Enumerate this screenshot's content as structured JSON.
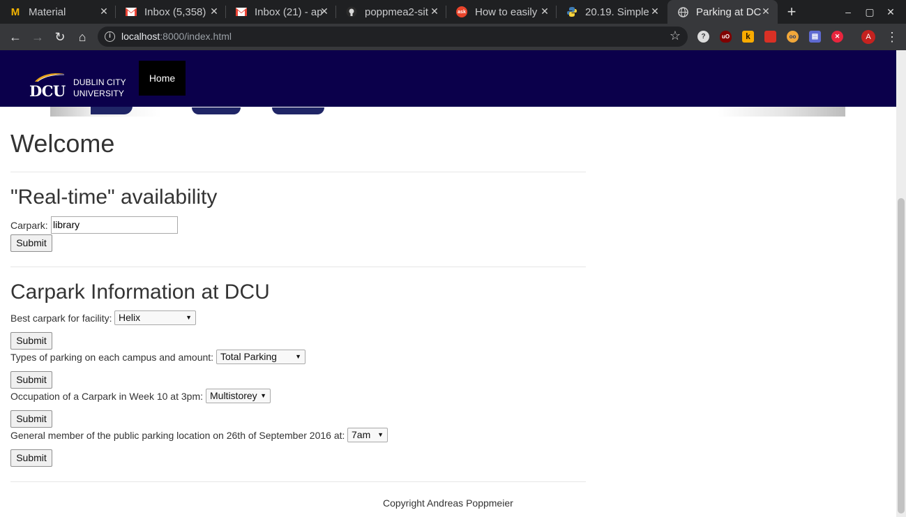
{
  "browser": {
    "tabs": [
      {
        "title": "Material",
        "favicon": "M",
        "favicon_color": "#f4b400",
        "active": false
      },
      {
        "title": "Inbox (5,358)",
        "favicon": "gmail",
        "favicon_color": "#ea4335",
        "active": false
      },
      {
        "title": "Inbox (21) - ap",
        "favicon": "gmail",
        "favicon_color": "#ea4335",
        "active": false
      },
      {
        "title": "poppmea2-sit",
        "favicon": "github",
        "favicon_color": "#ffffff",
        "active": false
      },
      {
        "title": "How to easily",
        "favicon": "ask",
        "favicon_color": "#e8442b",
        "active": false
      },
      {
        "title": "20.19. Simple",
        "favicon": "python",
        "favicon_color": "#3d7ab2",
        "active": false
      },
      {
        "title": "Parking at DC",
        "favicon": "globe",
        "favicon_color": "#cfcfcf",
        "active": true
      }
    ],
    "new_tab_label": "+",
    "window_controls": {
      "minimize": "–",
      "maximize": "▢",
      "close": "✕"
    },
    "nav": {
      "back": "←",
      "forward": "→",
      "reload": "↻",
      "home": "⌂"
    },
    "address": {
      "host": "localhost",
      "rest": ":8000/index.html"
    },
    "bookmark_star": "☆",
    "extensions": [
      {
        "name": "help-icon",
        "label": "?",
        "color": "#dcdcdc",
        "text_color": "#37383b"
      },
      {
        "name": "ublock-icon",
        "label": "uO",
        "color": "#800000",
        "text_color": "#ffffff"
      },
      {
        "name": "keep-icon",
        "label": "k",
        "color": "#f9ab00",
        "text_color": "#2b1b00"
      },
      {
        "name": "bookmark-red-icon",
        "label": "",
        "color": "#d93025",
        "text_color": "#ffffff"
      },
      {
        "name": "owl-icon",
        "label": "oo",
        "color": "#f1a73a",
        "text_color": "#253a6b"
      },
      {
        "name": "reader-icon",
        "label": "▤",
        "color": "#5e6ad2",
        "text_color": "#ffffff"
      },
      {
        "name": "close-red-icon",
        "label": "✕",
        "color": "#e8253d",
        "text_color": "#ffffff"
      }
    ],
    "avatar_letter": "A",
    "menu_glyph": "⋮"
  },
  "site": {
    "logo": {
      "mark": "DCU",
      "line1": "DUBLIN CITY",
      "line2": "UNIVERSITY"
    },
    "nav_home": "Home",
    "welcome": "Welcome",
    "realtime": {
      "heading": "\"Real-time\" availability",
      "carpark_label": "Carpark:",
      "carpark_value": "library",
      "submit": "Submit"
    },
    "info": {
      "heading": "Carpark Information at DCU",
      "q1_label": "Best carpark for facility:",
      "q1_value": "Helix",
      "q2_label": "Types of parking on each campus and amount:",
      "q2_value": "Total Parking",
      "q3_label": "Occupation of a Carpark in Week 10 at 3pm:",
      "q3_value": "Multistorey",
      "q4_label": "General member of the public parking location on 26th of September 2016 at:",
      "q4_value": "7am",
      "submit": "Submit"
    },
    "footer": "Copyright Andreas Poppmeier"
  }
}
